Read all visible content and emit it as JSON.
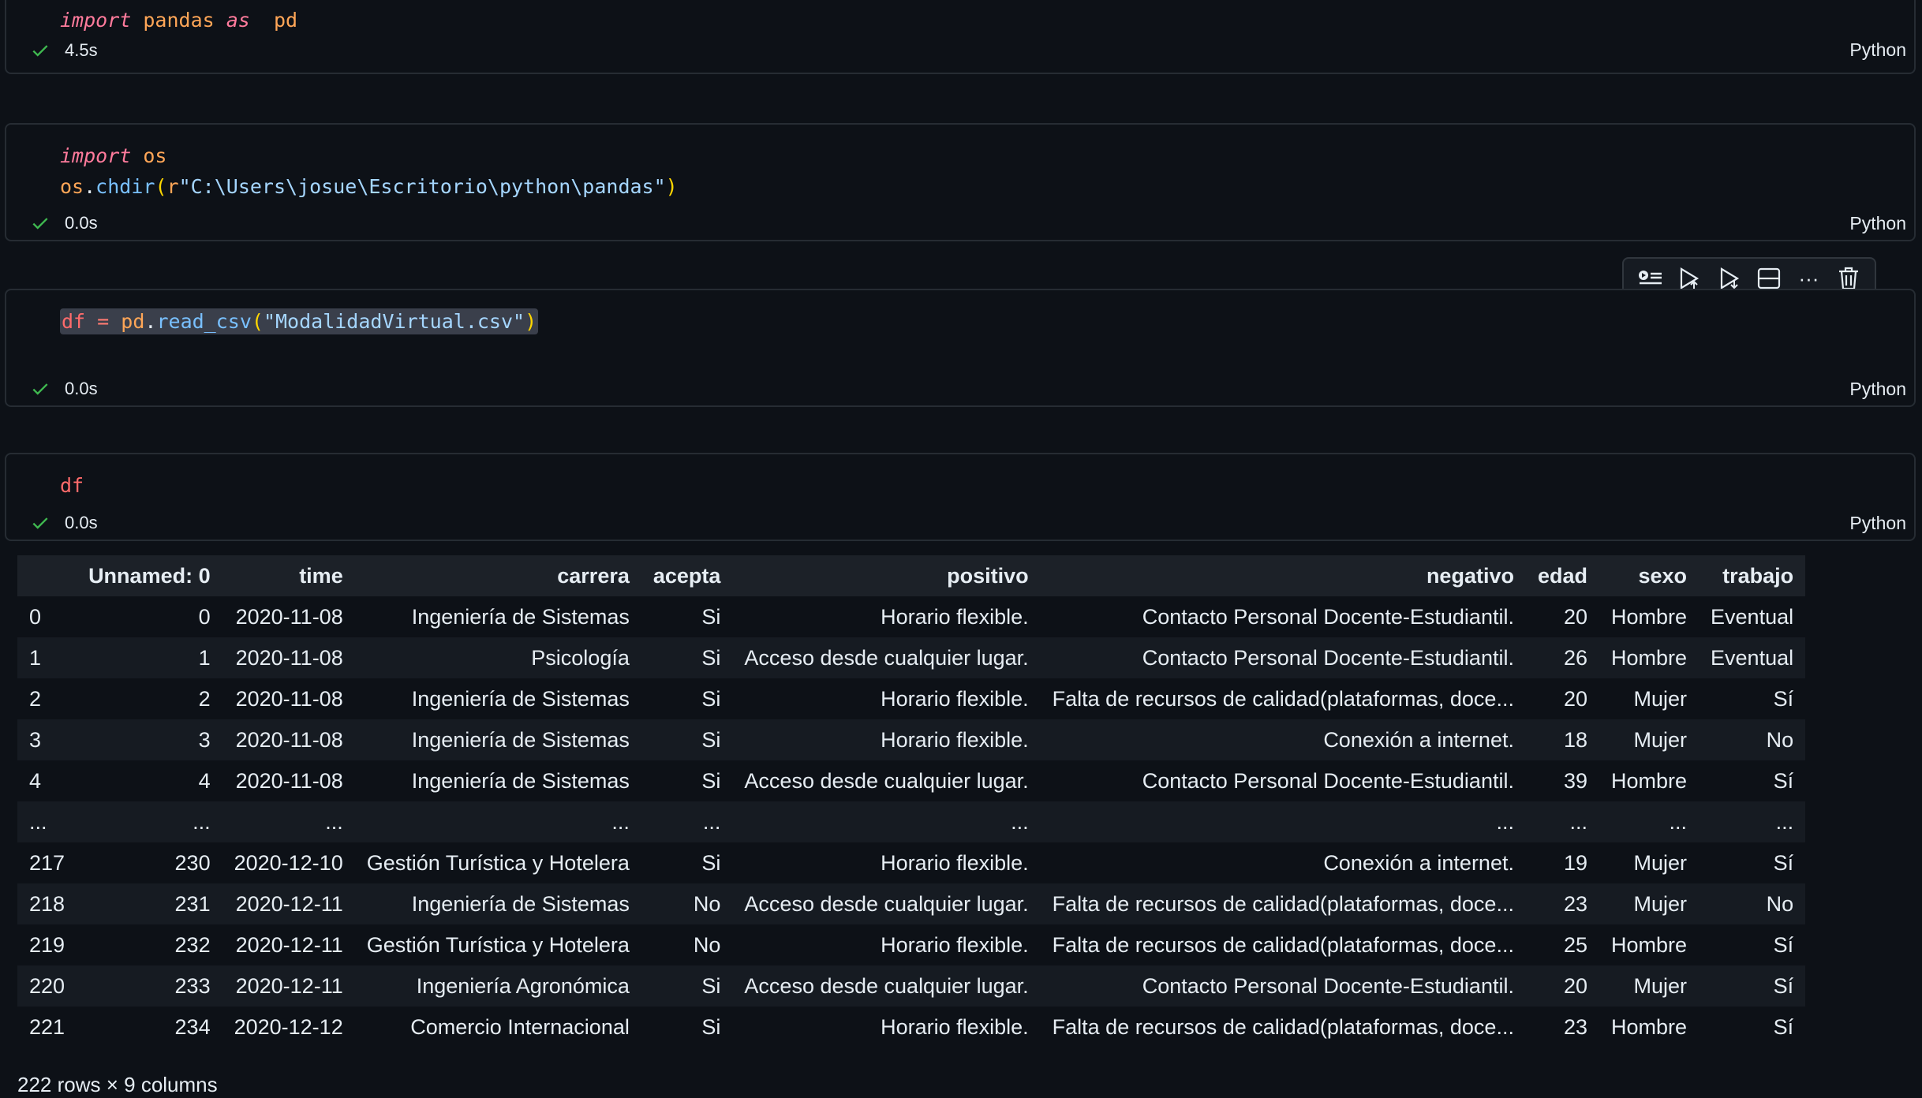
{
  "cells": [
    {
      "code": {
        "kw": "import",
        "lib": "pandas",
        "as": "as",
        "alias": "pd"
      },
      "time": "4.5s",
      "lang": "Python"
    },
    {
      "code": {
        "kw": "import",
        "lib": "os",
        "line2_obj": "os",
        "line2_fn": "chdir",
        "line2_prefix": "r",
        "line2_str": "\"C:\\Users\\josue\\Escritorio\\python\\pandas\""
      },
      "time": "0.0s",
      "lang": "Python"
    },
    {
      "code": {
        "var": "df",
        "eq": "=",
        "obj": "pd",
        "fn": "read_csv",
        "str": "\"ModalidadVirtual.csv\""
      },
      "time": "0.0s",
      "lang": "Python"
    },
    {
      "code": {
        "var": "df"
      },
      "time": "0.0s",
      "lang": "Python"
    }
  ],
  "toolbar": {
    "icons": [
      "run-by-line-icon",
      "execute-above-icon",
      "execute-below-icon",
      "split-cell-icon",
      "more-icon",
      "delete-icon"
    ],
    "more_label": "···"
  },
  "table": {
    "columns": [
      "",
      "Unnamed: 0",
      "time",
      "carrera",
      "acepta",
      "positivo",
      "negativo",
      "edad",
      "sexo",
      "trabajo"
    ],
    "rows": [
      [
        "0",
        "0",
        "2020-11-08",
        "Ingeniería de Sistemas",
        "Si",
        "Horario flexible.",
        "Contacto Personal Docente-Estudiantil.",
        "20",
        "Hombre",
        "Eventual"
      ],
      [
        "1",
        "1",
        "2020-11-08",
        "Psicología",
        "Si",
        "Acceso desde cualquier lugar.",
        "Contacto Personal Docente-Estudiantil.",
        "26",
        "Hombre",
        "Eventual"
      ],
      [
        "2",
        "2",
        "2020-11-08",
        "Ingeniería de Sistemas",
        "Si",
        "Horario flexible.",
        "Falta de recursos de calidad(plataformas, doce...",
        "20",
        "Mujer",
        "Sí"
      ],
      [
        "3",
        "3",
        "2020-11-08",
        "Ingeniería de Sistemas",
        "Si",
        "Horario flexible.",
        "Conexión a internet.",
        "18",
        "Mujer",
        "No"
      ],
      [
        "4",
        "4",
        "2020-11-08",
        "Ingeniería de Sistemas",
        "Si",
        "Acceso desde cualquier lugar.",
        "Contacto Personal Docente-Estudiantil.",
        "39",
        "Hombre",
        "Sí"
      ],
      [
        "...",
        "...",
        "...",
        "...",
        "...",
        "...",
        "...",
        "...",
        "...",
        "..."
      ],
      [
        "217",
        "230",
        "2020-12-10",
        "Gestión Turística y Hotelera",
        "Si",
        "Horario flexible.",
        "Conexión a internet.",
        "19",
        "Mujer",
        "Sí"
      ],
      [
        "218",
        "231",
        "2020-12-11",
        "Ingeniería de Sistemas",
        "No",
        "Acceso desde cualquier lugar.",
        "Falta de recursos de calidad(plataformas, doce...",
        "23",
        "Mujer",
        "No"
      ],
      [
        "219",
        "232",
        "2020-12-11",
        "Gestión Turística y Hotelera",
        "No",
        "Horario flexible.",
        "Falta de recursos de calidad(plataformas, doce...",
        "25",
        "Hombre",
        "Sí"
      ],
      [
        "220",
        "233",
        "2020-12-11",
        "Ingeniería Agronómica",
        "Si",
        "Acceso desde cualquier lugar.",
        "Contacto Personal Docente-Estudiantil.",
        "20",
        "Mujer",
        "Sí"
      ],
      [
        "221",
        "234",
        "2020-12-12",
        "Comercio Internacional",
        "Si",
        "Horario flexible.",
        "Falta de recursos de calidad(plataformas, doce...",
        "23",
        "Hombre",
        "Sí"
      ]
    ],
    "shape": "222 rows × 9 columns"
  },
  "colors": {
    "background": "#0d1117",
    "check": "#3fb950",
    "keyword": "#ff7b9c",
    "module": "#ffa657",
    "function": "#79c0ff",
    "string": "#a5d6ff"
  }
}
